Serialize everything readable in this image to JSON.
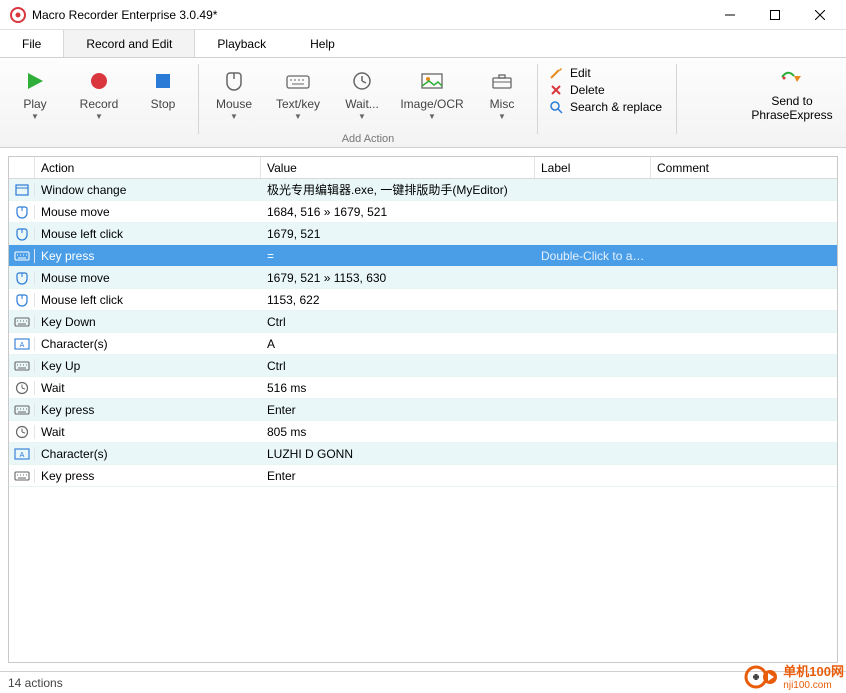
{
  "title": "Macro Recorder Enterprise 3.0.49*",
  "menu": {
    "file": "File",
    "record_edit": "Record and Edit",
    "playback": "Playback",
    "help": "Help"
  },
  "ribbon": {
    "play": "Play",
    "record": "Record",
    "stop": "Stop",
    "mouse": "Mouse",
    "textkey": "Text/key",
    "wait": "Wait...",
    "imageocr": "Image/OCR",
    "misc": "Misc",
    "add_action_group": "Add Action",
    "edit": "Edit",
    "delete": "Delete",
    "search_replace": "Search & replace",
    "sendto": "Send to",
    "phraseexpress": "PhraseExpress"
  },
  "columns": {
    "action": "Action",
    "value": "Value",
    "label": "Label",
    "comment": "Comment"
  },
  "selected_placeholder": "Double-Click to add",
  "selected_index": 3,
  "rows": [
    {
      "icon": "window",
      "action": "Window change",
      "value": "极光专用编辑器.exe, 一键排版助手(MyEditor)"
    },
    {
      "icon": "mouse",
      "action": "Mouse move",
      "value": "1684, 516 » 1679, 521"
    },
    {
      "icon": "mouse",
      "action": "Mouse left click",
      "value": "1679, 521"
    },
    {
      "icon": "keyboard",
      "action": "Key press",
      "value": "="
    },
    {
      "icon": "mouse",
      "action": "Mouse move",
      "value": "1679, 521 » 1153, 630"
    },
    {
      "icon": "mouse",
      "action": "Mouse left click",
      "value": "1153, 622"
    },
    {
      "icon": "keyboard",
      "action": "Key Down",
      "value": "Ctrl"
    },
    {
      "icon": "chars",
      "action": "Character(s)",
      "value": "A"
    },
    {
      "icon": "keyboard",
      "action": "Key Up",
      "value": "Ctrl"
    },
    {
      "icon": "clock",
      "action": "Wait",
      "value": "516 ms"
    },
    {
      "icon": "keyboard",
      "action": "Key press",
      "value": "Enter"
    },
    {
      "icon": "clock",
      "action": "Wait",
      "value": "805 ms"
    },
    {
      "icon": "chars",
      "action": "Character(s)",
      "value": "LUZHI D GONN"
    },
    {
      "icon": "keyboard",
      "action": "Key press",
      "value": "Enter"
    }
  ],
  "status": "14 actions",
  "watermark": {
    "line1": "单机100网",
    "line2": "nji100.com"
  }
}
